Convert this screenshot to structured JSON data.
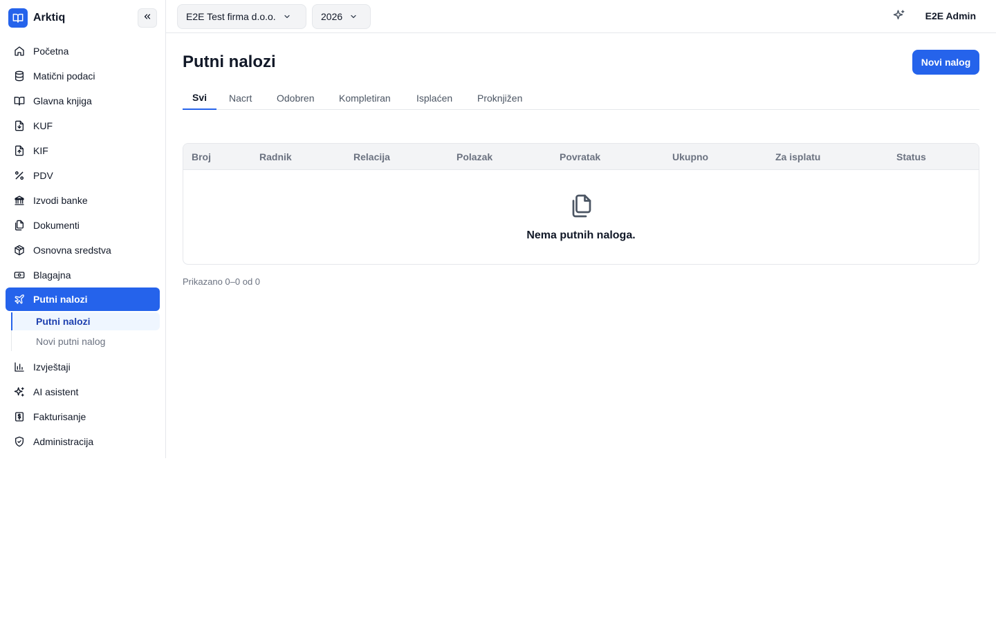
{
  "app": {
    "name": "Arktiq"
  },
  "sidebar": {
    "items": [
      {
        "label": "Početna",
        "icon": "home-icon"
      },
      {
        "label": "Matični podaci",
        "icon": "database-icon"
      },
      {
        "label": "Glavna knjiga",
        "icon": "book-open-icon"
      },
      {
        "label": "KUF",
        "icon": "file-download-icon"
      },
      {
        "label": "KIF",
        "icon": "file-upload-icon"
      },
      {
        "label": "PDV",
        "icon": "percent-icon"
      },
      {
        "label": "Izvodi banke",
        "icon": "bank-icon"
      },
      {
        "label": "Dokumenti",
        "icon": "documents-icon"
      },
      {
        "label": "Osnovna sredstva",
        "icon": "package-icon"
      },
      {
        "label": "Blagajna",
        "icon": "banknote-icon"
      },
      {
        "label": "Putni nalozi",
        "icon": "plane-icon",
        "active": true
      },
      {
        "label": "Izvještaji",
        "icon": "bar-chart-icon"
      },
      {
        "label": "AI asistent",
        "icon": "sparkles-icon"
      },
      {
        "label": "Fakturisanje",
        "icon": "invoice-dollar-icon"
      },
      {
        "label": "Administracija",
        "icon": "shield-check-icon"
      }
    ],
    "subitems": [
      {
        "label": "Putni nalozi",
        "active": true
      },
      {
        "label": "Novi putni nalog"
      }
    ]
  },
  "topbar": {
    "company": "E2E Test firma d.o.o.",
    "year": "2026",
    "user": "E2E Admin"
  },
  "main": {
    "title": "Putni nalozi",
    "new_button": "Novi nalog",
    "tabs": [
      "Svi",
      "Nacrt",
      "Odobren",
      "Kompletiran",
      "Isplaćen",
      "Proknjižen"
    ],
    "table": {
      "columns": [
        "Broj",
        "Radnik",
        "Relacija",
        "Polazak",
        "Povratak",
        "Ukupno",
        "Za isplatu",
        "Status"
      ],
      "empty_text": "Nema putnih naloga."
    },
    "count_text": "Prikazano 0–0 od 0"
  },
  "colors": {
    "accent": "#2563eb",
    "active_sub_bg": "#eff6ff"
  }
}
